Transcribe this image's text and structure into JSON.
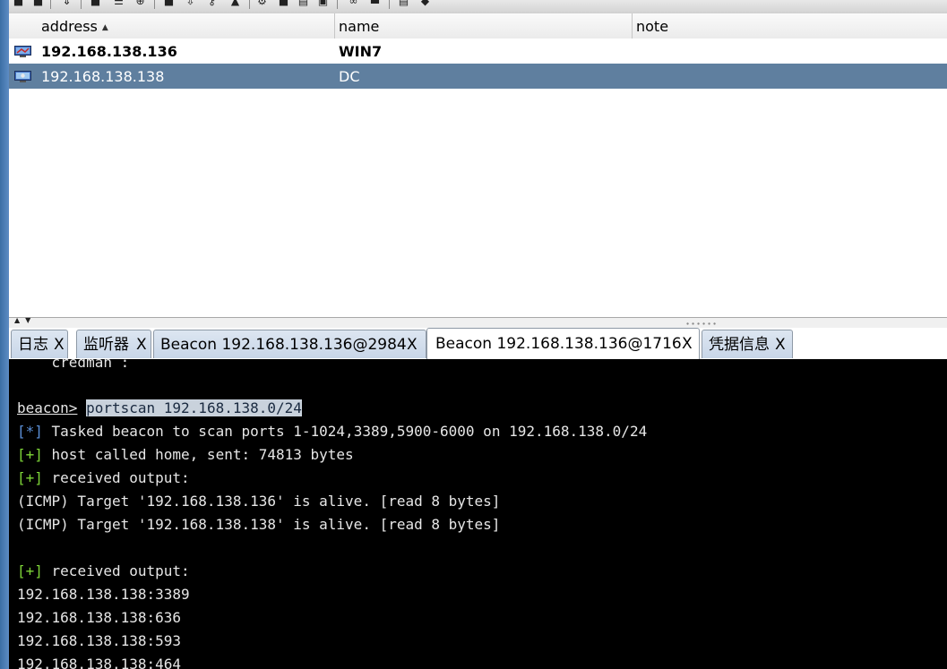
{
  "table": {
    "columns": [
      {
        "key": "address",
        "label": "address",
        "sorted": "ascending"
      },
      {
        "key": "name",
        "label": "name"
      },
      {
        "key": "note",
        "label": "note"
      }
    ],
    "rows": [
      {
        "address": "192.168.138.136",
        "name": "WIN7",
        "note": "",
        "icon": "monitor-icon",
        "bold": true,
        "selected": false
      },
      {
        "address": "192.168.138.138",
        "name": "DC",
        "note": "",
        "icon": "monitor-icon",
        "bold": false,
        "selected": true
      }
    ]
  },
  "tabs": [
    {
      "label": "日志",
      "close": "X",
      "active": false
    },
    {
      "label": "监听器",
      "close": "X",
      "active": false
    },
    {
      "label": "Beacon 192.168.138.136@2984",
      "close": "X",
      "active": false
    },
    {
      "label": "Beacon 192.168.138.136@1716",
      "close": "X",
      "active": true
    },
    {
      "label": "凭据信息",
      "close": "X",
      "active": false
    }
  ],
  "console": {
    "partial_line": "    credman :",
    "prompt": "beacon>",
    "command": "portscan 192.168.138.0/24",
    "lines": [
      {
        "tag": "[*]",
        "tag_type": "info",
        "text": " Tasked beacon to scan ports 1-1024,3389,5900-6000 on 192.168.138.0/24"
      },
      {
        "tag": "[+]",
        "tag_type": "ok",
        "text": " host called home, sent: 74813 bytes"
      },
      {
        "tag": "[+]",
        "tag_type": "ok",
        "text": " received output:"
      },
      {
        "tag": "",
        "tag_type": "",
        "text": "(ICMP) Target '192.168.138.136' is alive. [read 8 bytes]"
      },
      {
        "tag": "",
        "tag_type": "",
        "text": "(ICMP) Target '192.168.138.138' is alive. [read 8 bytes]"
      },
      {
        "tag": "",
        "tag_type": "",
        "text": ""
      },
      {
        "tag": "[+]",
        "tag_type": "ok",
        "text": " received output:"
      },
      {
        "tag": "",
        "tag_type": "",
        "text": "192.168.138.138:3389"
      },
      {
        "tag": "",
        "tag_type": "",
        "text": "192.168.138.138:636"
      },
      {
        "tag": "",
        "tag_type": "",
        "text": "192.168.138.138:593"
      },
      {
        "tag": "",
        "tag_type": "",
        "text": "192.168.138.138:464"
      }
    ]
  },
  "colors": {
    "selected_row": "#5f7f9f",
    "console_bg": "#000000",
    "console_text": "#e6e6e6",
    "tag_info": "#5b8fd6",
    "tag_ok": "#7dd337",
    "command_highlight": "#c9d2dc"
  },
  "toolbar_icons": [
    "connect-icon",
    "disconnect-icon",
    "preferences-icon",
    "pivot-graph-icon",
    "session-table-icon",
    "targets-icon",
    "listeners-icon",
    "screenshot-icon",
    "download-icon",
    "key-icon",
    "image-icon",
    "settings-icon",
    "coffee-icon",
    "clipboard-icon",
    "console-icon",
    "link-icon",
    "terminal-icon",
    "notes-icon",
    "package-icon"
  ]
}
